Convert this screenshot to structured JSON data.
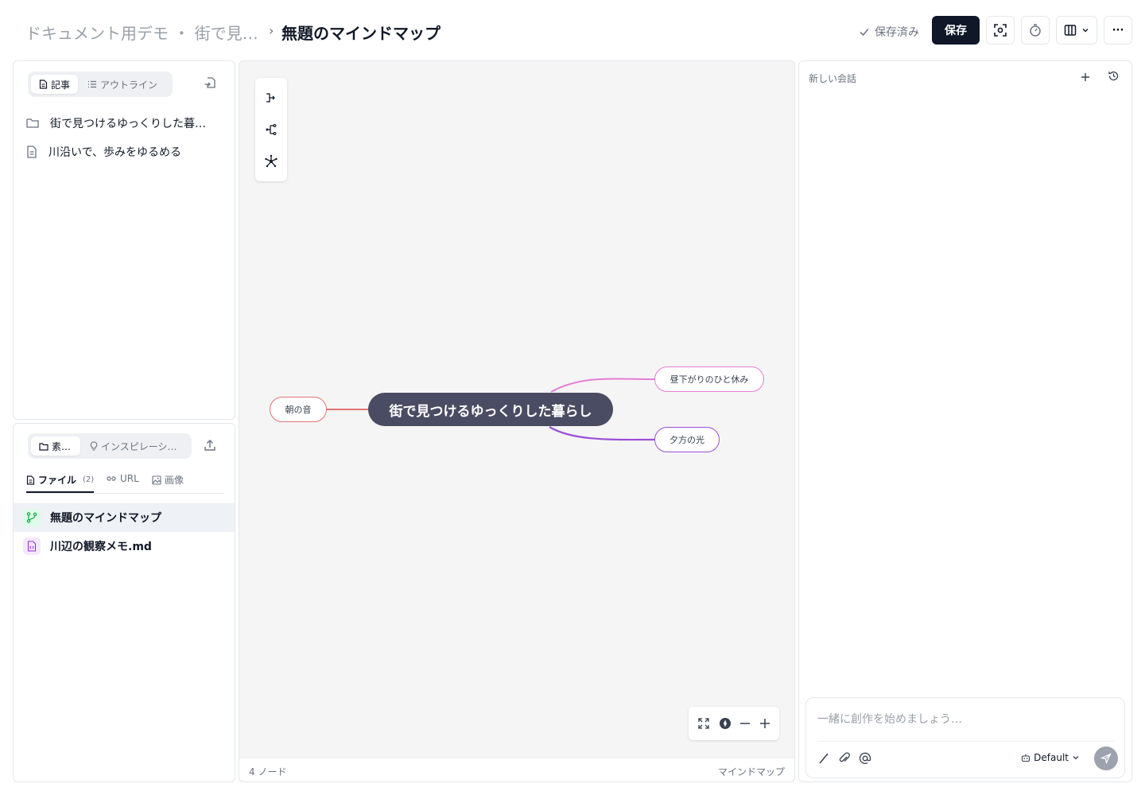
{
  "header": {
    "breadcrumb_parent": "ドキュメント用デモ ・ 街で見…",
    "breadcrumb_sep": "›",
    "title": "無題のマインドマップ",
    "saved_status": "保存済み",
    "save_label": "保存",
    "more_label": "···"
  },
  "left_top": {
    "tabs": [
      "記事",
      "アウトライン"
    ],
    "items": [
      {
        "icon": "folder-icon",
        "label": "街で見つけるゆっくりした暮…"
      },
      {
        "icon": "document-icon",
        "label": "川沿いで、歩みをゆるめる"
      }
    ]
  },
  "left_bottom": {
    "tabs": [
      "素…",
      "インスピレーシ…"
    ],
    "file_tabs": [
      {
        "label": "ファイル",
        "count": "(2)"
      },
      {
        "label": "URL"
      },
      {
        "label": "画像"
      }
    ],
    "files": [
      {
        "icon": "mindmap-icon",
        "name": "無題のマインドマップ",
        "selected": true,
        "color": "#16a34a"
      },
      {
        "icon": "code-file-icon",
        "name": "川辺の観察メモ.md",
        "selected": false,
        "color": "#9333ea"
      }
    ]
  },
  "mindmap": {
    "root": "街で見つけるゆっくりした暮らし",
    "nodes": [
      {
        "label": "朝の音",
        "color": "#e57373"
      },
      {
        "label": "昼下がりのひと休み",
        "color": "#e67ed4"
      },
      {
        "label": "夕方の光",
        "color": "#9b4fd8"
      }
    ],
    "node_count": "4 ノード",
    "mode_label": "マインドマップ"
  },
  "chat": {
    "title": "新しい会話",
    "placeholder": "一緒に創作を始めましょう…",
    "model": "Default"
  }
}
